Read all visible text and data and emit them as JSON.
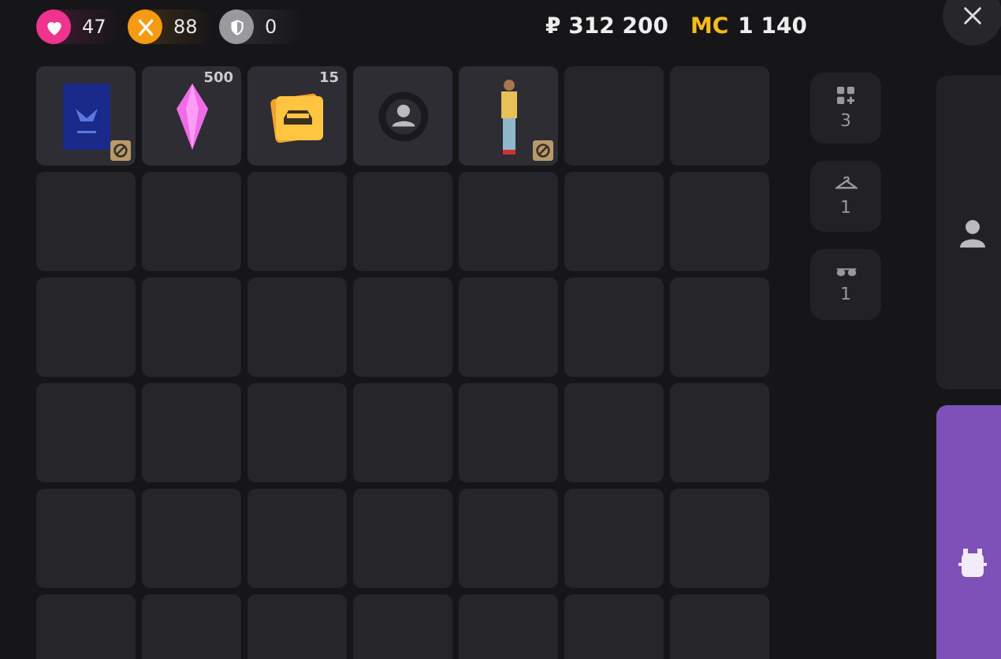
{
  "stats": [
    {
      "kind": "health",
      "value": "47",
      "color": "#f0338f"
    },
    {
      "kind": "food",
      "value": "88",
      "color": "#f59a12"
    },
    {
      "kind": "armor",
      "value": "0",
      "color": "#9a9a9e"
    }
  ],
  "balance": {
    "rubles": "₽ 312 200",
    "mc_label": "MC",
    "mc_value": "1 140"
  },
  "inventory": [
    {
      "kind": "passport",
      "blocked": true
    },
    {
      "kind": "crystal",
      "count": "500",
      "blocked": false
    },
    {
      "kind": "car-card",
      "count": "15",
      "blocked": false
    },
    {
      "kind": "avatar-frame",
      "blocked": false
    },
    {
      "kind": "character",
      "blocked": true
    }
  ],
  "categories": [
    {
      "kind": "all",
      "count": "3"
    },
    {
      "kind": "clothes",
      "count": "1"
    },
    {
      "kind": "accessories",
      "count": "1"
    }
  ],
  "panels": [
    {
      "kind": "profile",
      "selected": false
    },
    {
      "kind": "backpack",
      "selected": true
    }
  ]
}
